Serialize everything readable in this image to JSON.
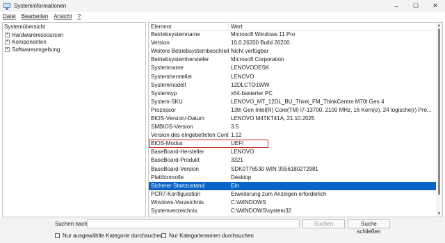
{
  "window": {
    "title": "Systeminformationen",
    "controls": {
      "minimize": "–",
      "maximize": "☐",
      "close": "✕"
    }
  },
  "menu": [
    "Datei",
    "Bearbeiten",
    "Ansicht",
    "?"
  ],
  "tree": {
    "root": "Systemübersicht",
    "children": [
      "Hardwareressourcen",
      "Komponenten",
      "Softwareumgebung"
    ]
  },
  "table": {
    "headers": {
      "item": "Element",
      "value": "Wert"
    },
    "rows": [
      {
        "item": "Betriebsystemname",
        "value": "Microsoft Windows 11 Pro"
      },
      {
        "item": "Version",
        "value": "10.0.26200 Build 26200"
      },
      {
        "item": "Weitere Betriebsystembeschreib...",
        "value": "Nicht verfügbar"
      },
      {
        "item": "Betriebsystemhersteller",
        "value": "Microsoft Corporation"
      },
      {
        "item": "Systemname",
        "value": "LENOVODESK"
      },
      {
        "item": "Systemhersteller",
        "value": "LENOVO"
      },
      {
        "item": "Systemmodell",
        "value": "12DLCTO1WW"
      },
      {
        "item": "Systemtyp",
        "value": "x64-basierter PC"
      },
      {
        "item": "System-SKU",
        "value": "LENOVO_MT_12DL_BU_Think_FM_ThinkCentre M70t Gen 4"
      },
      {
        "item": "Prozessor",
        "value": "13th Gen Intel(R) Core(TM) i7-13700, 2100 MHz, 16 Kern(e), 24 logische(r) Pro..."
      },
      {
        "item": "BIOS-Version/-Datum",
        "value": "LENOVO M4TKT41A, 21.10.2025"
      },
      {
        "item": "SMBIOS-Version",
        "value": "3.5"
      },
      {
        "item": "Version des eingebetteten Contr...",
        "value": "1.12"
      },
      {
        "item": "BIOS-Modus",
        "value": "UEFI"
      },
      {
        "item": "BaseBoard-Hersteller",
        "value": "LENOVO"
      },
      {
        "item": "BaseBoard-Produkt",
        "value": "3321"
      },
      {
        "item": "BaseBoard-Version",
        "value": "SDK0T76530 WIN 3556180272981"
      },
      {
        "item": "Plattformrolle",
        "value": "Desktop"
      },
      {
        "item": "Sicherer Startzustand",
        "value": "Ein"
      },
      {
        "item": "PCR7-Konfiguration",
        "value": "Erweiterung zum Anzeigen erforderlich"
      },
      {
        "item": "Windows-Verzeichnis",
        "value": "C:\\WINDOWS"
      },
      {
        "item": "Systemverzeichnis",
        "value": "C:\\WINDOWS\\system32"
      }
    ],
    "highlighted_item": "BIOS-Modus",
    "selected_item": "Sicherer Startzustand"
  },
  "search": {
    "label": "Suchen nach:",
    "value": "",
    "search_button": "Suchen",
    "close_button": "Suche schließen",
    "option_selected_category": "Nur ausgewählte Kategorie durchsuchen",
    "option_category_names": "Nur Kategorienamen durchsuchen"
  },
  "colors": {
    "selection": "#0a64c8",
    "highlight_outline": "#d62222",
    "window_chrome": "#f3f3f3"
  }
}
